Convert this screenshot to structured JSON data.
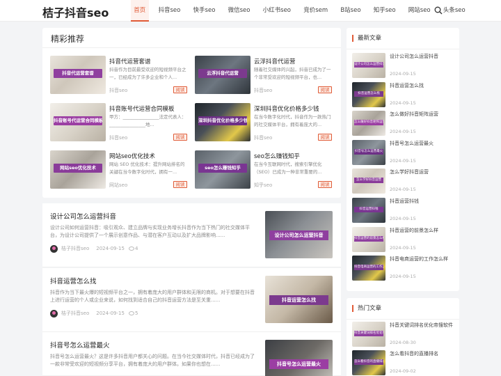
{
  "site": {
    "logo": "桔子抖音seo"
  },
  "nav": {
    "items": [
      "首页",
      "抖音seo",
      "快手seo",
      "微信seo",
      "小红书seo",
      "竞价sem",
      "B站seo",
      "知乎seo",
      "网站seo",
      "头条seo"
    ],
    "active": 0
  },
  "colors": {
    "accent": "#e05a36"
  },
  "featured": {
    "title": "精彩推荐",
    "read_label": "阅读",
    "items": [
      {
        "title": "抖音代运营套谱",
        "desc": "抖音作为目前最受欢迎的短视频平台之一，已经成为了许多企业和个人...",
        "cat": "抖音seo",
        "cap": "抖音代运营套谱"
      },
      {
        "title": "云浮抖音代运营",
        "desc": "随着社交媒体的兴起，抖音已成为了一个非常受欢迎的短视频平台，也...",
        "cat": "抖音seo",
        "cap": "云浮抖音代运营"
      },
      {
        "title": "抖音账号代运营合同模板",
        "desc": "甲方：________________法定代表人：________________地...",
        "cat": "抖音seo",
        "cap": "抖音账号代运营合同模板"
      },
      {
        "title": "深圳抖音优化价格多少钱",
        "desc": "在当今数字化时代，抖音作为一款热门的社交媒体平台，拥有着庞大的...",
        "cat": "抖音seo",
        "cap": "深圳抖音优化价格多少钱"
      },
      {
        "title": "网站seo优化技术",
        "desc": "网站 SEO 优化技术：提升网站排名的关键在当今数字化时代，拥有一...",
        "cat": "网站seo",
        "cap": "网站seo优化技术"
      },
      {
        "title": "seo怎么赚钱知乎",
        "desc": "在当今互联网时代，搜索引擎优化（SEO）已成为一种非常重要的...",
        "cat": "知乎seo",
        "cap": "seo怎么赚钱知乎"
      }
    ]
  },
  "posts": [
    {
      "title": "设计公司怎么运营抖音",
      "desc": "设计公司如何运营抖音：吸引观众、建立品牌与实现业务增长抖音作为当下热门的社交媒体平台，为设计公司提供了一个展示创意作品、与潜在客户互动以及扩大品牌影响......",
      "author": "桔子抖音seo",
      "date": "2024-09-15",
      "views": "4",
      "cap": "设计公司怎么运营抖音"
    },
    {
      "title": "抖音运营怎么找",
      "desc": "抖音作为当下最火爆的短视频平台之一，拥有着庞大的用户群体和无限的商机。对于想要在抖音上进行运营的个人或企业来说，如何找到适合自己的抖音运营方法是至关重......",
      "author": "桔子抖音seo",
      "date": "2024-09-15",
      "views": "5",
      "cap": "抖音运营怎么找"
    },
    {
      "title": "抖音号怎么运营最火",
      "desc": "抖音号怎么运营最火？这是许多抖音用户都关心的问题。在当今社交媒体时代，抖音已经成为了一款非常受欢迎的短视频分享平台，拥有着庞大的用户群体。如果你也想在......",
      "author": "",
      "date": "",
      "views": "",
      "cap": "抖音号怎么运营最火"
    }
  ],
  "latest": {
    "title": "最新文章",
    "items": [
      {
        "title": "设计公司怎么运营抖音",
        "date": "2024-09-15",
        "cap": "设计公司怎么运营抖音"
      },
      {
        "title": "抖音运营怎么找",
        "date": "2024-09-15",
        "cap": "抖音运营怎么找"
      },
      {
        "title": "怎么做好抖音矩阵运营",
        "date": "2024-09-15",
        "cap": "怎么做好抖音矩阵运营"
      },
      {
        "title": "抖音号怎么运营最火",
        "date": "2024-09-15",
        "cap": "抖音号怎么运营最火"
      },
      {
        "title": "怎么学好抖音运营",
        "date": "2024-09-15",
        "cap": "怎么学好抖音运营"
      },
      {
        "title": "抖音运营抖钱",
        "date": "2024-09-15",
        "cap": "抖音运营抖钱"
      },
      {
        "title": "抖音运营的前景怎么样",
        "date": "2024-09-15",
        "cap": "抖音运营的前景怎么样"
      },
      {
        "title": "抖音电商运营的工作怎么样",
        "date": "2024-09-15",
        "cap": "抖音电商运营的工作怎么样"
      }
    ]
  },
  "hot": {
    "title": "热门文章",
    "items": [
      {
        "title": "抖音关键词排名优化帝搜软件",
        "date": "2024-08-30",
        "cap": "抖音关键词排名优化帝搜软件"
      },
      {
        "title": "怎么看抖音的直播排名",
        "date": "2024-09-02",
        "cap": "怎么看抖音的直播排名"
      }
    ]
  }
}
